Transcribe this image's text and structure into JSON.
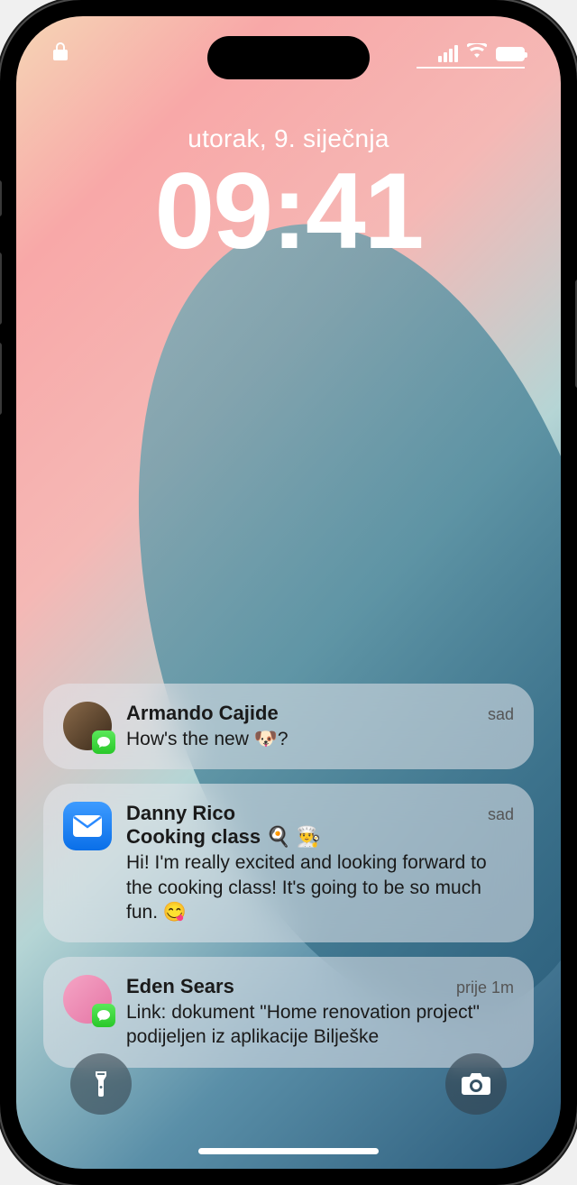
{
  "datetime": {
    "date": "utorak, 9. siječnja",
    "time": "09:41"
  },
  "notifications": [
    {
      "sender": "Armando Cajide",
      "subtitle": "",
      "body": "How's the new 🐶?",
      "time": "sad",
      "app": "messages-icon",
      "avatar_color": "#5a3a1a"
    },
    {
      "sender": "Danny Rico",
      "subtitle": "Cooking class 🍳 👨‍🍳",
      "body": "Hi! I'm really excited and looking forward to the cooking class! It's going to be so much fun. 😋",
      "time": "sad",
      "app": "mail-icon",
      "avatar_color": "#2a8aff"
    },
    {
      "sender": "Eden Sears",
      "subtitle": "",
      "body": "Link: dokument \"Home renovation project\" podijeljen iz aplikacije Bilješke",
      "time": "prije 1m",
      "app": "messages-icon",
      "avatar_color": "#f090c0"
    }
  ],
  "icons": {
    "lock": "lock",
    "signal": "signal",
    "wifi": "wifi",
    "battery": "battery-full",
    "flashlight": "flashlight",
    "camera": "camera"
  }
}
